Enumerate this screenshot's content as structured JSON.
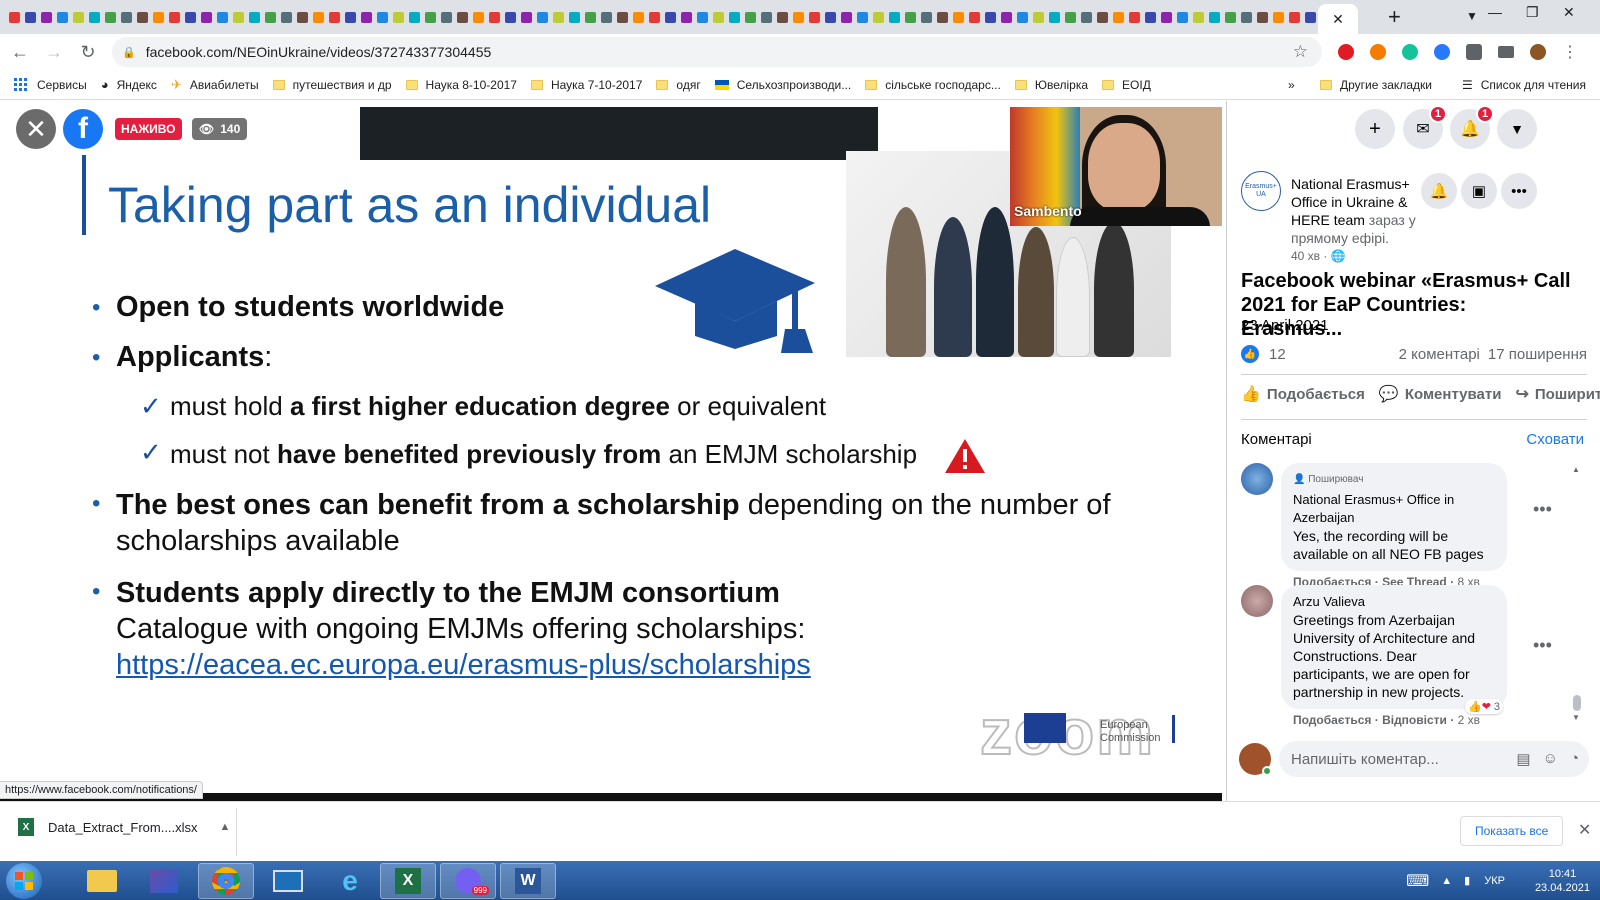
{
  "browser": {
    "active_tab_close": "✕",
    "new_tab": "+",
    "url": "facebook.com/NEOinUkraine/videos/372743377304455",
    "status_url": "https://www.facebook.com/notifications/"
  },
  "bookmarks": {
    "items": [
      "Сервисы",
      "Яндекс",
      "Авиабилеты",
      "путешествия и др",
      "Наука 8-10-2017",
      "Наука 7-10-2017",
      "одяг",
      "Сельхозпроизводи...",
      "сільське господарс...",
      "Ювелірка",
      "ЕОІД"
    ],
    "more": "»",
    "other": "Другие закладки",
    "reading_list": "Список для чтения"
  },
  "video": {
    "live_label": "НАЖИВО",
    "viewers": "140",
    "pip_name": "Sambento",
    "slide": {
      "title": "Taking part as an individual",
      "b1": "Open to students worldwide",
      "b2_bold": "Applicants",
      "b2_rest": ":",
      "s1_pre": "must hold ",
      "s1_bold": "a first higher education degree",
      "s1_post": " or equivalent",
      "s2_pre": "must not ",
      "s2_bold": "have benefited previously from",
      "s2_post": " an EMJM scholarship",
      "b3_bold": "The best ones can benefit from a scholarship",
      "b3_rest": " depending on the number of scholarships available",
      "b4_bold": "Students apply directly to the EMJM consortium",
      "b4_line2": "Catalogue with ongoing EMJMs offering scholarships:",
      "b4_link": "https://eacea.ec.europa.eu/erasmus-plus/scholarships",
      "zoom_logo": "zoom",
      "eu_line1": "European",
      "eu_line2": "Commission"
    }
  },
  "panel": {
    "author_logo": "Erasmus+ UA",
    "author_name": "National Erasmus+ Office in Ukraine & HERE team",
    "author_status": " зараз у прямому ефірі.",
    "meta_time": "40 хв",
    "meta_globe": "·",
    "messenger_badge": "1",
    "notif_badge": "1",
    "title": "Facebook webinar «Erasmus+ Call 2021 for EaP Countries: Erasmus...",
    "date": "23 April 2021",
    "likes": "12",
    "comments_count": "2 коментарі",
    "shares": "17 поширення",
    "act_like": "Подобається",
    "act_comment": "Коментувати",
    "act_share": "Поширити",
    "comments_label": "Коментарі",
    "hide": "Сховати",
    "comments": [
      {
        "fan": "Поширювач",
        "name": "National Erasmus+ Office in Azerbaijan",
        "text": "Yes, the recording will be available on all NEO FB pages",
        "like": "Подобається",
        "thread": "See Thread",
        "time": "8 хв"
      },
      {
        "name": "Arzu Valieva",
        "text": "Greetings from Azerbaijan University of Architecture and Constructions. Dear participants, we are open for partnership in new projects.",
        "like": "Подобається",
        "reply": "Відповісти",
        "time": "2 хв",
        "reactions": "3"
      }
    ],
    "compose_placeholder": "Напишіть коментар..."
  },
  "downloads": {
    "file": "Data_Extract_From....xlsx",
    "show_all": "Показать все"
  },
  "taskbar": {
    "lang": "УКР",
    "time": "10:41",
    "date": "23.04.2021",
    "viber_badge": "999"
  },
  "colors": {
    "facebook_blue": "#1877f2",
    "live_red": "#e41e3f",
    "slide_blue": "#1b5fa8"
  }
}
